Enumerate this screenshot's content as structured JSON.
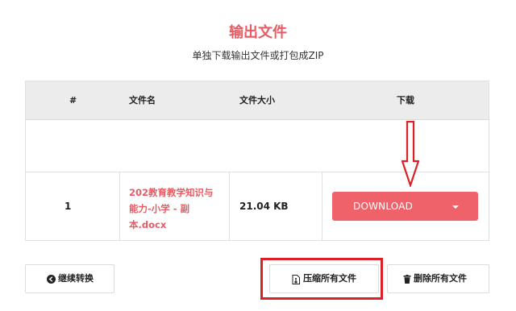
{
  "header": {
    "title": "输出文件",
    "subtitle": "单独下载输出文件或打包成ZIP"
  },
  "table": {
    "columns": [
      "#",
      "文件名",
      "文件大小",
      "下载"
    ],
    "rows": [
      {
        "index": "1",
        "filename_lines": [
          "202教育教学知识与",
          "能力-小学 - 副",
          "本.docx"
        ],
        "size": "21.04 KB",
        "download_label": "DOWNLOAD"
      }
    ]
  },
  "actions": {
    "continue_label": "继续转换",
    "compress_label": "压缩所有文件",
    "delete_label": "删除所有文件"
  },
  "colors": {
    "accent": "#e95a63",
    "download_button": "#f0626a",
    "annotation_red": "#dd1f26"
  },
  "icons": {
    "continue": "circle-arrow-left-icon",
    "compress": "zip-file-icon",
    "delete": "trash-icon",
    "dropdown": "caret-down-icon",
    "annotation": "red-down-arrow"
  }
}
